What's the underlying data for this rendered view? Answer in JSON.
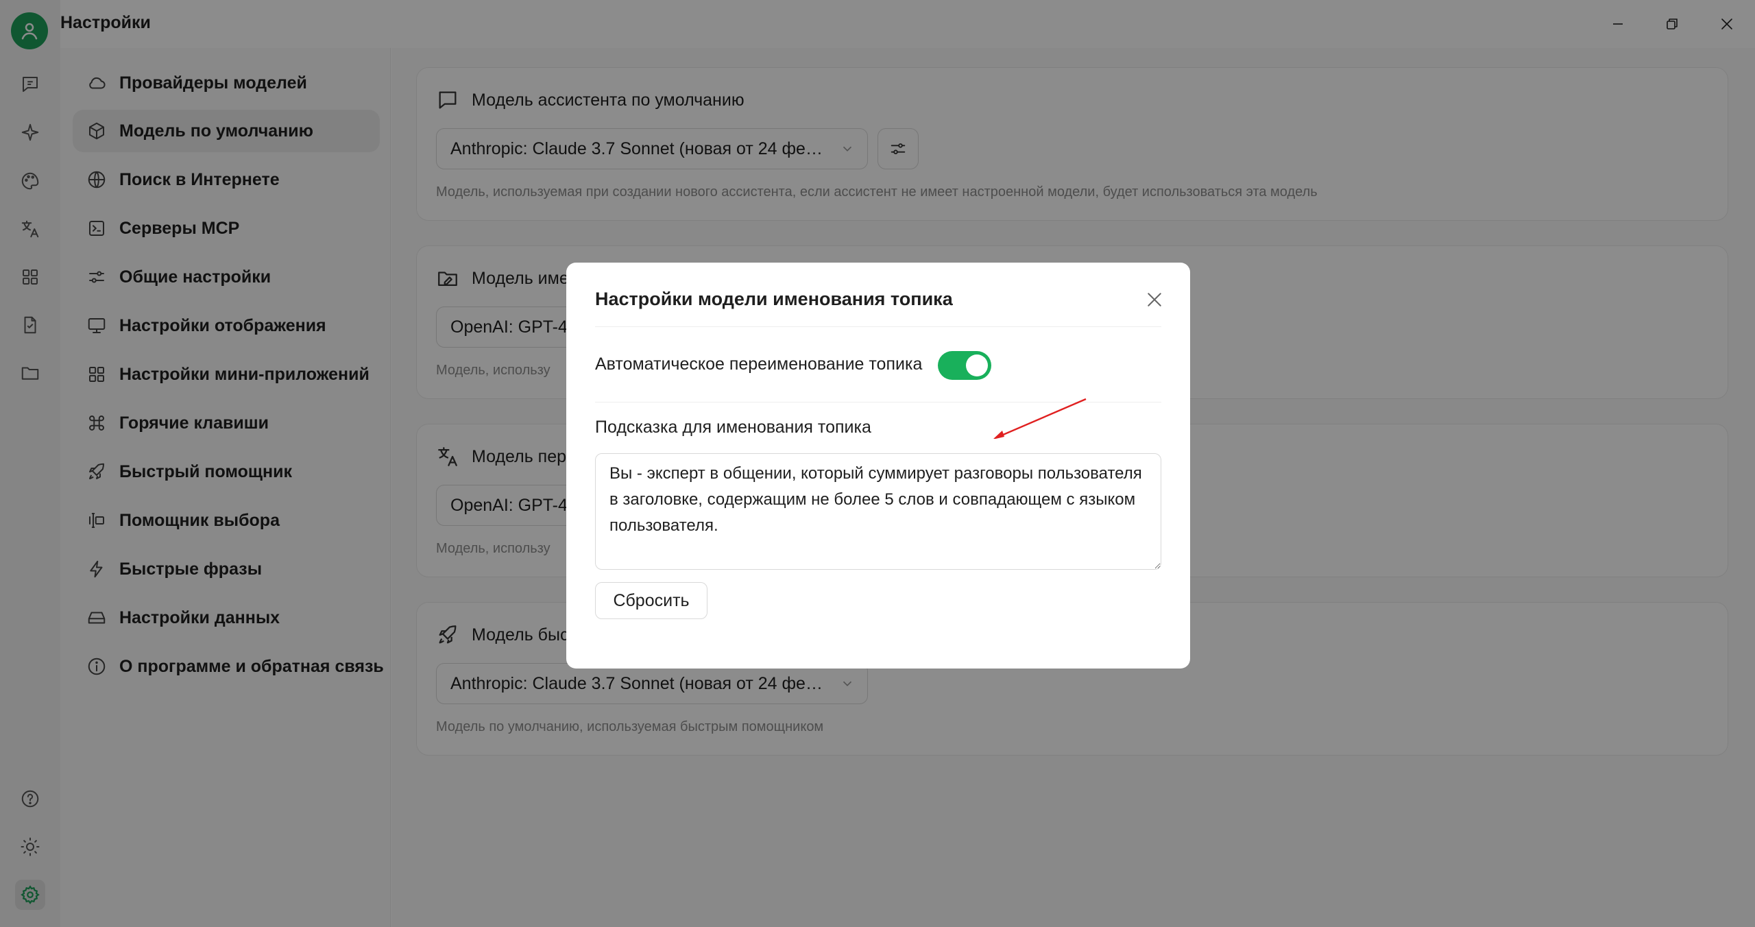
{
  "window": {
    "title": "Настройки"
  },
  "rail": {
    "items": [
      "chat-icon",
      "sparkle-icon",
      "palette-icon",
      "translate-icon",
      "apps-grid-icon",
      "document-icon",
      "folder-icon"
    ],
    "bottom": [
      "help-icon",
      "brightness-icon",
      "settings-icon"
    ]
  },
  "nav": {
    "items": [
      {
        "label": "Провайдеры моделей",
        "icon": "cloud-icon"
      },
      {
        "label": "Модель по умолчанию",
        "icon": "cube-icon"
      },
      {
        "label": "Поиск в Интернете",
        "icon": "globe-icon"
      },
      {
        "label": "Серверы MCP",
        "icon": "terminal-icon"
      },
      {
        "label": "Общие настройки",
        "icon": "sliders-icon"
      },
      {
        "label": "Настройки отображения",
        "icon": "monitor-icon"
      },
      {
        "label": "Настройки мини-приложений",
        "icon": "grid-icon"
      },
      {
        "label": "Горячие клавиши",
        "icon": "command-icon"
      },
      {
        "label": "Быстрый помощник",
        "icon": "rocket-icon"
      },
      {
        "label": "Помощник выбора",
        "icon": "text-select-icon"
      },
      {
        "label": "Быстрые фразы",
        "icon": "zap-icon"
      },
      {
        "label": "Настройки данных",
        "icon": "hard-drive-icon"
      },
      {
        "label": "О программе и обратная связь",
        "icon": "info-icon"
      }
    ],
    "active": "Модель по умолчанию"
  },
  "cards": [
    {
      "title": "Модель ассистента по умолчанию",
      "icon": "chat-square-icon",
      "select": "Anthropic: Claude 3.7 Sonnet (новая от 24 фев…",
      "desc": "Модель, используемая при создании нового ассистента, если ассистент не имеет настроенной модели, будет использоваться эта модель"
    },
    {
      "title": "Модель име",
      "icon": "folder-edit-icon",
      "select": "OpenAI: GPT-4c",
      "desc": "Модель, использу"
    },
    {
      "title": "Модель пер",
      "icon": "translate-icon",
      "select": "OpenAI: GPT-4c",
      "desc": "Модель, использу"
    },
    {
      "title": "Модель быс",
      "icon": "rocket-icon",
      "select": "Anthropic: Claude 3.7 Sonnet (новая от 24 фев…",
      "desc": "Модель по умолчанию, используемая быстрым помощником"
    }
  ],
  "modal": {
    "title": "Настройки модели именования топика",
    "toggle_label": "Автоматическое переименование топика",
    "toggle_on": true,
    "prompt_label": "Подсказка для именования топика",
    "prompt_value": "Вы - эксперт в общении, который суммирует разговоры пользователя в заголовке, содержащим не более 5 слов и совпадающем с языком пользователя.",
    "reset_label": "Сбросить"
  },
  "colors": {
    "accent": "#19b05b",
    "avatar": "#1e9e5a",
    "annotation_arrow": "#e02020"
  }
}
